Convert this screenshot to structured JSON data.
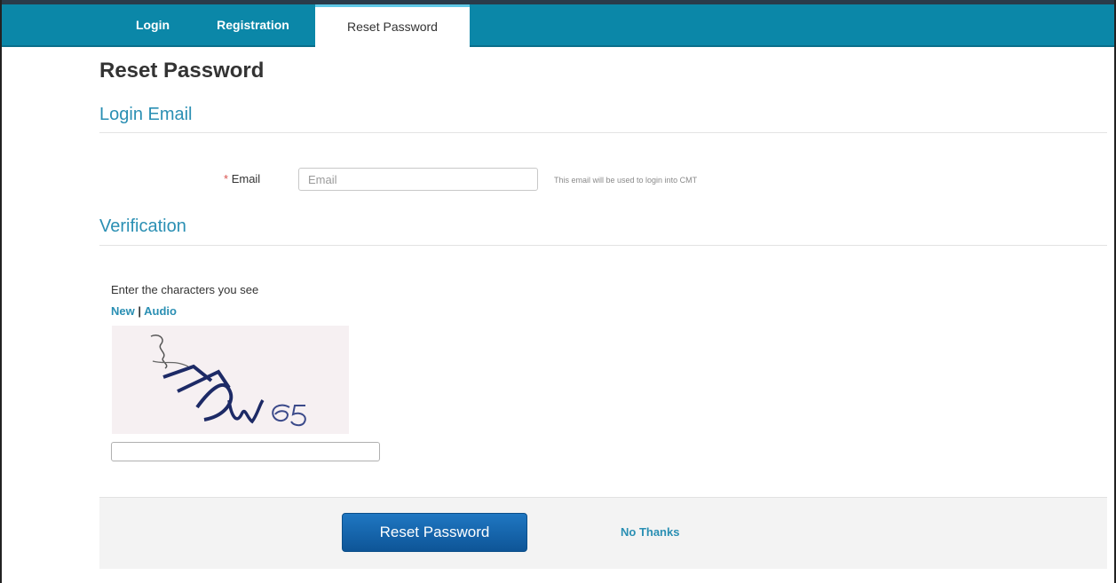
{
  "nav": {
    "tabs": [
      {
        "label": "Login"
      },
      {
        "label": "Registration"
      },
      {
        "label": "Reset Password"
      }
    ],
    "active_index": 2
  },
  "page": {
    "title": "Reset Password"
  },
  "sections": {
    "login_email": "Login Email",
    "verification": "Verification"
  },
  "email": {
    "required_marker": "*",
    "label": "Email",
    "placeholder": "Email",
    "value": "",
    "help": "This email will be used to login into CMT"
  },
  "captcha": {
    "prompt": "Enter the characters you see",
    "new_label": "New",
    "separator": "|",
    "audio_label": "Audio",
    "text": "ITDW65",
    "input_value": ""
  },
  "actions": {
    "reset_label": "Reset Password",
    "no_thanks_label": "No Thanks"
  },
  "colors": {
    "nav_background": "#0b87a8",
    "section_heading": "#2a8fb3",
    "primary_button": "#1466ad",
    "required": "#d9534f"
  }
}
